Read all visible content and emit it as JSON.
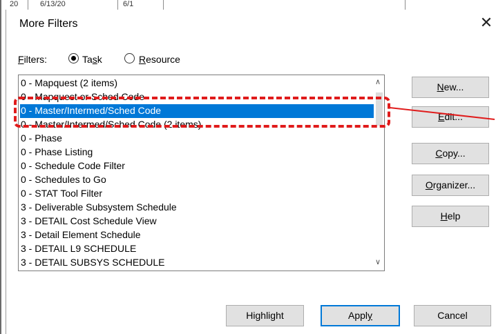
{
  "background": {
    "cells": [
      "20",
      "6/13/20",
      "6/1"
    ]
  },
  "dialog": {
    "title": "More Filters",
    "close_symbol": "✕",
    "filters_label_prefix": "F",
    "filters_label_rest": "ilters:",
    "radio_task": {
      "prefix": "Ta",
      "accel": "s",
      "rest": "k",
      "checked": true
    },
    "radio_resource": {
      "accel": "R",
      "rest": "esource",
      "checked": false
    }
  },
  "filter_list": {
    "items": [
      "0 - Mapquest (2 items)",
      "0 - Mapquest or Sched Code",
      "0 - Master/Intermed/Sched Code",
      "0 - Master/Intermed/Sched Code (2 items)",
      "0 - Phase",
      "0 - Phase Listing",
      "0 - Schedule Code Filter",
      "0 - Schedules to Go",
      "0 - STAT Tool Filter",
      "3 - Deliverable Subsystem Schedule",
      "3 - DETAIL Cost Schedule View",
      "3 - Detail Element Schedule",
      "3 - DETAIL L9 SCHEDULE",
      "3 - DETAIL SUBSYS SCHEDULE"
    ],
    "selected_index": 2,
    "scroll_up": "∧",
    "scroll_down": "∨"
  },
  "side_buttons": {
    "new": {
      "accel": "N",
      "rest": "ew..."
    },
    "edit": {
      "accel": "E",
      "rest": "dit..."
    },
    "copy": {
      "accel": "C",
      "rest": "opy..."
    },
    "organizer": {
      "accel": "O",
      "rest": "rganizer..."
    },
    "help": {
      "accel": "H",
      "rest": "elp"
    }
  },
  "bottom_buttons": {
    "highlight": {
      "pre": "Hi",
      "accel": "g",
      "rest": "hlight"
    },
    "apply": {
      "pre": "Appl",
      "accel": "y",
      "rest": ""
    },
    "cancel": "Cancel"
  },
  "colors": {
    "selection": "#0078d7",
    "annotation_red": "#e01b1b"
  }
}
